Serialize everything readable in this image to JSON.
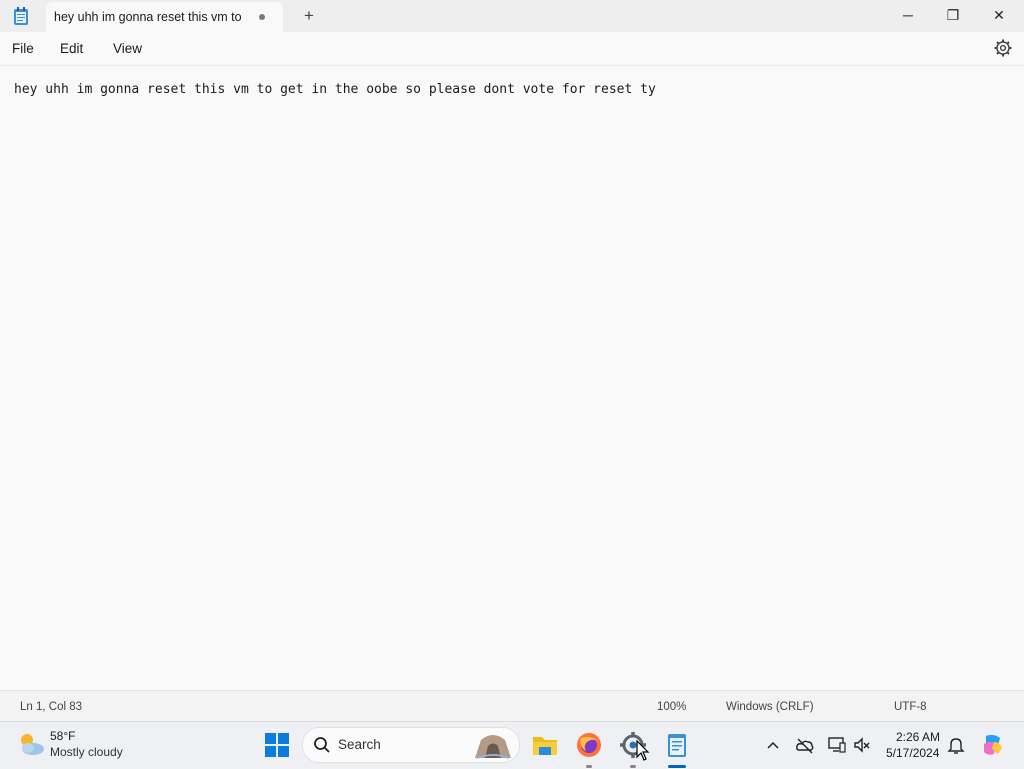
{
  "window": {
    "tab_title": "hey uhh im gonna reset this vm to",
    "new_tab_label": "+",
    "minimize_label": "─",
    "maximize_label": "❐",
    "close_label": "✕"
  },
  "menu": {
    "items": [
      {
        "label": "File"
      },
      {
        "label": "Edit"
      },
      {
        "label": "View"
      }
    ],
    "settings_icon": "gear-icon"
  },
  "editor": {
    "content": "hey uhh im gonna reset this vm to get in the oobe so please dont vote for reset ty"
  },
  "status": {
    "position": "Ln 1, Col 83",
    "zoom": "100%",
    "line_ending": "Windows (CRLF)",
    "encoding": "UTF-8"
  },
  "taskbar": {
    "weather": {
      "temp": "58°F",
      "desc": "Mostly cloudy",
      "icon": "cloud-sun-icon"
    },
    "search_placeholder": "Search",
    "apps": [
      "start-icon",
      "file-explorer-icon",
      "firefox-icon",
      "settings-icon",
      "notepad-icon"
    ],
    "clock": {
      "time": "2:26 AM",
      "date": "5/17/2024"
    }
  },
  "colors": {
    "accent": "#0067c0",
    "background": "#f9f9f9",
    "taskbar": "#eef0f4"
  }
}
